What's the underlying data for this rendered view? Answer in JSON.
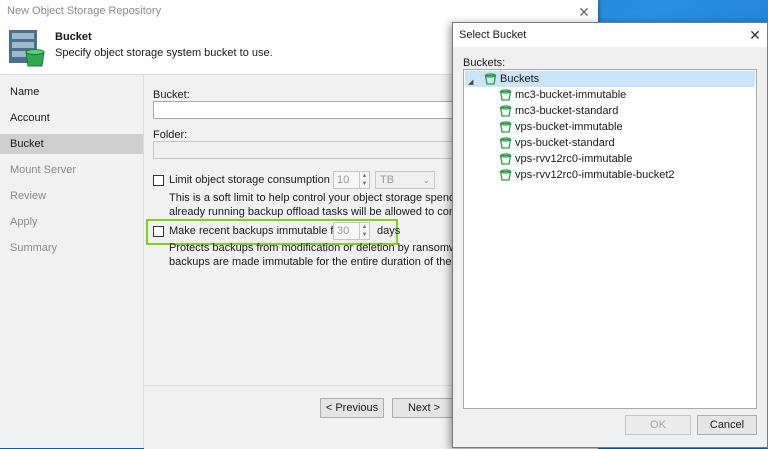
{
  "window": {
    "title": "New Object Storage Repository"
  },
  "header": {
    "title": "Bucket",
    "subtitle": "Specify object storage system bucket to use."
  },
  "nav": [
    {
      "label": "Name",
      "state": "done"
    },
    {
      "label": "Account",
      "state": "done"
    },
    {
      "label": "Bucket",
      "state": "active"
    },
    {
      "label": "Mount Server",
      "state": "pending"
    },
    {
      "label": "Review",
      "state": "pending"
    },
    {
      "label": "Apply",
      "state": "pending"
    },
    {
      "label": "Summary",
      "state": "pending"
    }
  ],
  "form": {
    "bucket_label": "Bucket:",
    "bucket_value": "",
    "folder_label": "Folder:",
    "folder_value": "",
    "limit_label": "Limit object storage consumption to:",
    "limit_value": "10",
    "limit_unit": "TB",
    "limit_hint_1": "This is a soft limit to help control your object storage spend. If the sp",
    "limit_hint_2": "already running backup offload tasks will be allowed to complete, bu",
    "immutable_label": "Make recent backups immutable for:",
    "immutable_value": "30",
    "immutable_unit": "days",
    "immutable_hint_1": "Protects backups from modification or deletion by ransomware, ma",
    "immutable_hint_2": "backups are made immutable for the entire duration of their retentio"
  },
  "footer": {
    "previous_label": "< Previous",
    "next_label": "Next >"
  },
  "dialog": {
    "title": "Select Bucket",
    "buckets_label": "Buckets:",
    "root_label": "Buckets",
    "items": [
      "mc3-bucket-immutable",
      "mc3-bucket-standard",
      "vps-bucket-immutable",
      "vps-bucket-standard",
      "vps-rvv12rc0-immutable",
      "vps-rvv12rc0-immutable-bucket2"
    ],
    "ok_label": "OK",
    "cancel_label": "Cancel"
  },
  "colors": {
    "highlight": "#7ed321",
    "selection": "#cce4f7",
    "bucket_icon": "#2e9e44"
  }
}
